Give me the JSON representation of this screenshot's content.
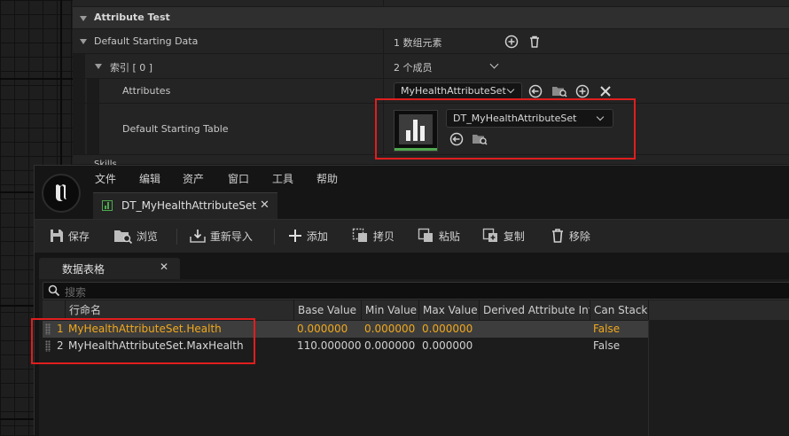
{
  "details": {
    "section_title": "Attribute Test",
    "rows": {
      "default_starting_data": {
        "label": "Default Starting Data",
        "value": "1 数组元素"
      },
      "index": {
        "label": "索引 [ 0 ]",
        "value": "2 个成员"
      },
      "attributes": {
        "label": "Attributes",
        "value": "MyHealthAttributeSet"
      },
      "default_starting_table": {
        "label": "Default Starting Table",
        "value": "DT_MyHealthAttributeSet"
      }
    },
    "cut_off_label": "Skills"
  },
  "editor": {
    "menu": [
      "文件",
      "编辑",
      "资产",
      "窗口",
      "工具",
      "帮助"
    ],
    "document_tab": "DT_MyHealthAttributeSet",
    "toolbar": {
      "save": "保存",
      "browse": "浏览",
      "reimport": "重新导入",
      "add": "添加",
      "copy": "拷贝",
      "paste": "粘贴",
      "duplicate": "复制",
      "remove": "移除"
    },
    "panel_tab": "数据表格",
    "search_placeholder": "搜索",
    "columns": [
      "行命名",
      "Base Value",
      "Min Value",
      "Max Value",
      "Derived Attribute Info",
      "Can Stack"
    ],
    "rows": [
      {
        "index": "1",
        "name": "MyHealthAttributeSet.Health",
        "base": "0.000000",
        "min": "0.000000",
        "max": "0.000000",
        "derived": "",
        "can_stack": "False",
        "selected": true
      },
      {
        "index": "2",
        "name": "MyHealthAttributeSet.MaxHealth",
        "base": "110.000000",
        "min": "0.000000",
        "max": "0.000000",
        "derived": "",
        "can_stack": "False",
        "selected": false
      }
    ]
  },
  "colors": {
    "highlight_red": "#e01e1e",
    "selected_text": "#f0a81c",
    "panel_bg": "#242424",
    "selected_row_bg": "#3d3d3d"
  }
}
